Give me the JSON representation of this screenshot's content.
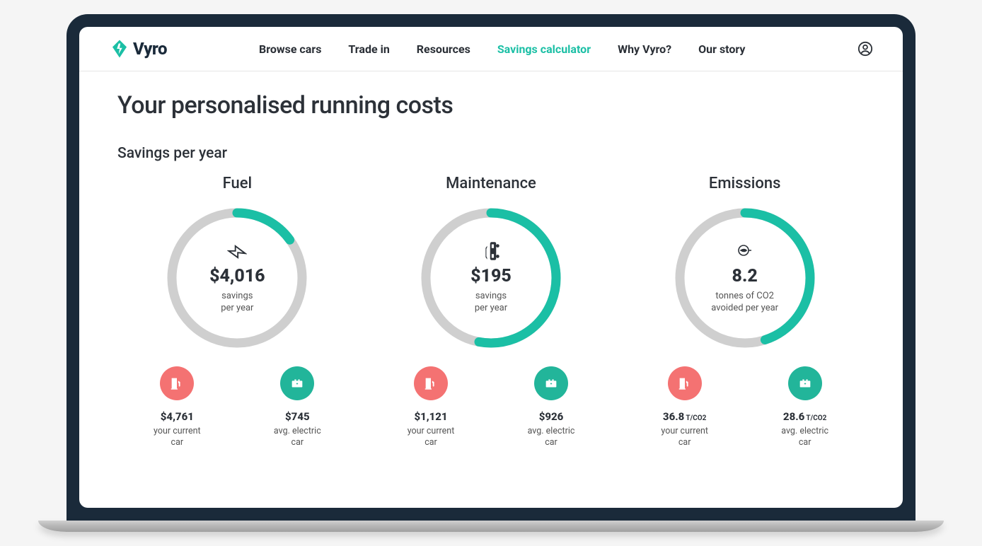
{
  "brand": {
    "name": "Vyro"
  },
  "nav": {
    "items": [
      {
        "label": "Browse cars",
        "active": false
      },
      {
        "label": "Trade in",
        "active": false
      },
      {
        "label": "Resources",
        "active": false
      },
      {
        "label": "Savings calculator",
        "active": true
      },
      {
        "label": "Why Vyro?",
        "active": false
      },
      {
        "label": "Our story",
        "active": false
      }
    ]
  },
  "page": {
    "title": "Your personalised running costs",
    "section_label": "Savings per year"
  },
  "colors": {
    "accent": "#1bbfa5",
    "track": "#cfcfcf",
    "negative": "#f47272",
    "positive": "#22b59a"
  },
  "metrics": [
    {
      "id": "fuel",
      "title": "Fuel",
      "icon": "bolt",
      "value": "$4,016",
      "sub": "savings\nper year",
      "progress_pct": 15,
      "current": {
        "value": "$4,761",
        "label": "your current\ncar"
      },
      "electric": {
        "value": "$745",
        "label": "avg. electric\ncar"
      }
    },
    {
      "id": "maintenance",
      "title": "Maintenance",
      "icon": "wrench-car",
      "value": "$195",
      "sub": "savings\nper year",
      "progress_pct": 53,
      "current": {
        "value": "$1,121",
        "label": "your current\ncar"
      },
      "electric": {
        "value": "$926",
        "label": "avg. electric\ncar"
      }
    },
    {
      "id": "emissions",
      "title": "Emissions",
      "icon": "leaf",
      "value": "8.2",
      "sub": "tonnes of CO2\navoided per year",
      "progress_pct": 45,
      "current": {
        "value": "36.8",
        "unit": "T/CO2",
        "label": "your current\ncar"
      },
      "electric": {
        "value": "28.6",
        "unit": "T/CO2",
        "label": "avg. electric\ncar"
      }
    }
  ],
  "chart_data": [
    {
      "type": "donut-gauge",
      "title": "Fuel",
      "center_value": 4016,
      "center_label": "savings per year ($)",
      "progress_pct": 15,
      "series": [
        {
          "name": "your current car",
          "value": 4761,
          "unit": "$"
        },
        {
          "name": "avg. electric car",
          "value": 745,
          "unit": "$"
        }
      ]
    },
    {
      "type": "donut-gauge",
      "title": "Maintenance",
      "center_value": 195,
      "center_label": "savings per year ($)",
      "progress_pct": 53,
      "series": [
        {
          "name": "your current car",
          "value": 1121,
          "unit": "$"
        },
        {
          "name": "avg. electric car",
          "value": 926,
          "unit": "$"
        }
      ]
    },
    {
      "type": "donut-gauge",
      "title": "Emissions",
      "center_value": 8.2,
      "center_label": "tonnes of CO2 avoided per year",
      "progress_pct": 45,
      "series": [
        {
          "name": "your current car",
          "value": 36.8,
          "unit": "T/CO2"
        },
        {
          "name": "avg. electric car",
          "value": 28.6,
          "unit": "T/CO2"
        }
      ]
    }
  ]
}
